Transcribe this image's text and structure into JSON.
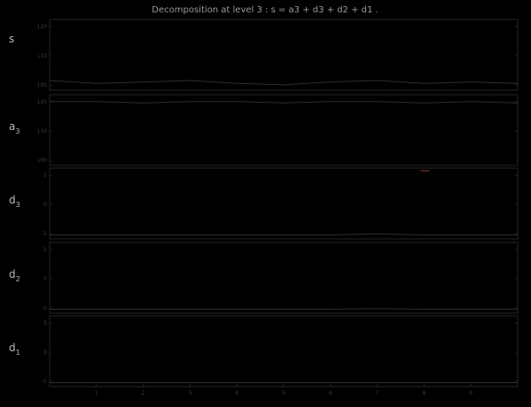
{
  "chart_data": {
    "type": "line",
    "title": "Decomposition at level 3 : s = a3 + d3 + d2 + d1 .",
    "background": "#000000",
    "axis_color": "#242424",
    "line_color": "#2f2f2f",
    "accent_color": "#8a3a2a",
    "grid": false,
    "x": [
      1,
      1000,
      2000,
      3000,
      4000,
      5000,
      6000,
      7000,
      8000,
      9000,
      10000
    ],
    "x_tick_labels": [
      "1",
      "2",
      "3",
      "4",
      "5",
      "6",
      "7",
      "8",
      "9"
    ],
    "panels": [
      {
        "label": "s",
        "subscript": "",
        "y_tick_labels": [
          "100",
          "110",
          "120"
        ],
        "values": [
          101,
          100,
          100.5,
          101,
          100,
          99.5,
          100.5,
          101,
          100,
          100.5,
          100
        ]
      },
      {
        "label": "a",
        "subscript": "3",
        "y_tick_labels": [
          "100",
          "110",
          "120"
        ],
        "values": [
          120,
          120,
          119.5,
          120,
          120,
          119.5,
          120,
          120,
          119.5,
          120,
          119.5
        ]
      },
      {
        "label": "d",
        "subscript": "3",
        "y_tick_labels": [
          "-5",
          "0",
          "5"
        ],
        "values": [
          -5.5,
          -5.5,
          -5.5,
          -5.5,
          -5.5,
          -5.5,
          -5.5,
          -5.3,
          -5.5,
          -5.5,
          -5.5
        ]
      },
      {
        "label": "d",
        "subscript": "2",
        "y_tick_labels": [
          "-5",
          "0",
          "5"
        ],
        "values": [
          -5.5,
          -5.5,
          -5.5,
          -5.5,
          -5.5,
          -5.5,
          -5.5,
          -5.4,
          -5.5,
          -5.5,
          -5.5
        ]
      },
      {
        "label": "d",
        "subscript": "1",
        "y_tick_labels": [
          "-5",
          "0",
          "5"
        ],
        "values": [
          -5.5,
          -5.5,
          -5.5,
          -5.5,
          -5.5,
          -5.5,
          -5.5,
          -5.5,
          -5.5,
          -5.5,
          -5.5
        ]
      }
    ]
  }
}
